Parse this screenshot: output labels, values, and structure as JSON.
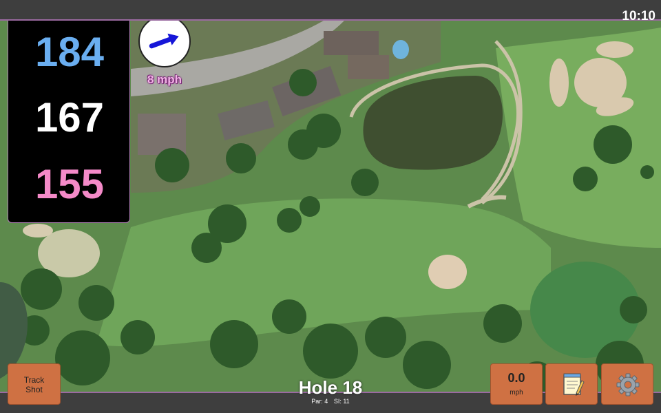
{
  "status_bar": {
    "time": "10:10"
  },
  "distances": {
    "back": {
      "value": "184",
      "color": "#6aaef0"
    },
    "middle": {
      "value": "167",
      "color": "#ffffff"
    },
    "front": {
      "value": "155",
      "color": "#f48ac8"
    }
  },
  "wind": {
    "speed_label": "8 mph",
    "direction": "east-northeast",
    "arrow_color": "#1616d8"
  },
  "buttons": {
    "track_shot": {
      "line1": "Track",
      "line2": "Shot"
    },
    "shot_speed": {
      "value": "0.0",
      "unit": "mph"
    },
    "notes_icon": "notepad-icon",
    "settings_icon": "gear-icon"
  },
  "hole": {
    "title": "Hole 18",
    "par": "Par: 4",
    "stroke_index": "SI: 11"
  },
  "colors": {
    "button": "#cf7143",
    "bar": "#3e3e3e",
    "accent_border": "#9a6aa0"
  }
}
